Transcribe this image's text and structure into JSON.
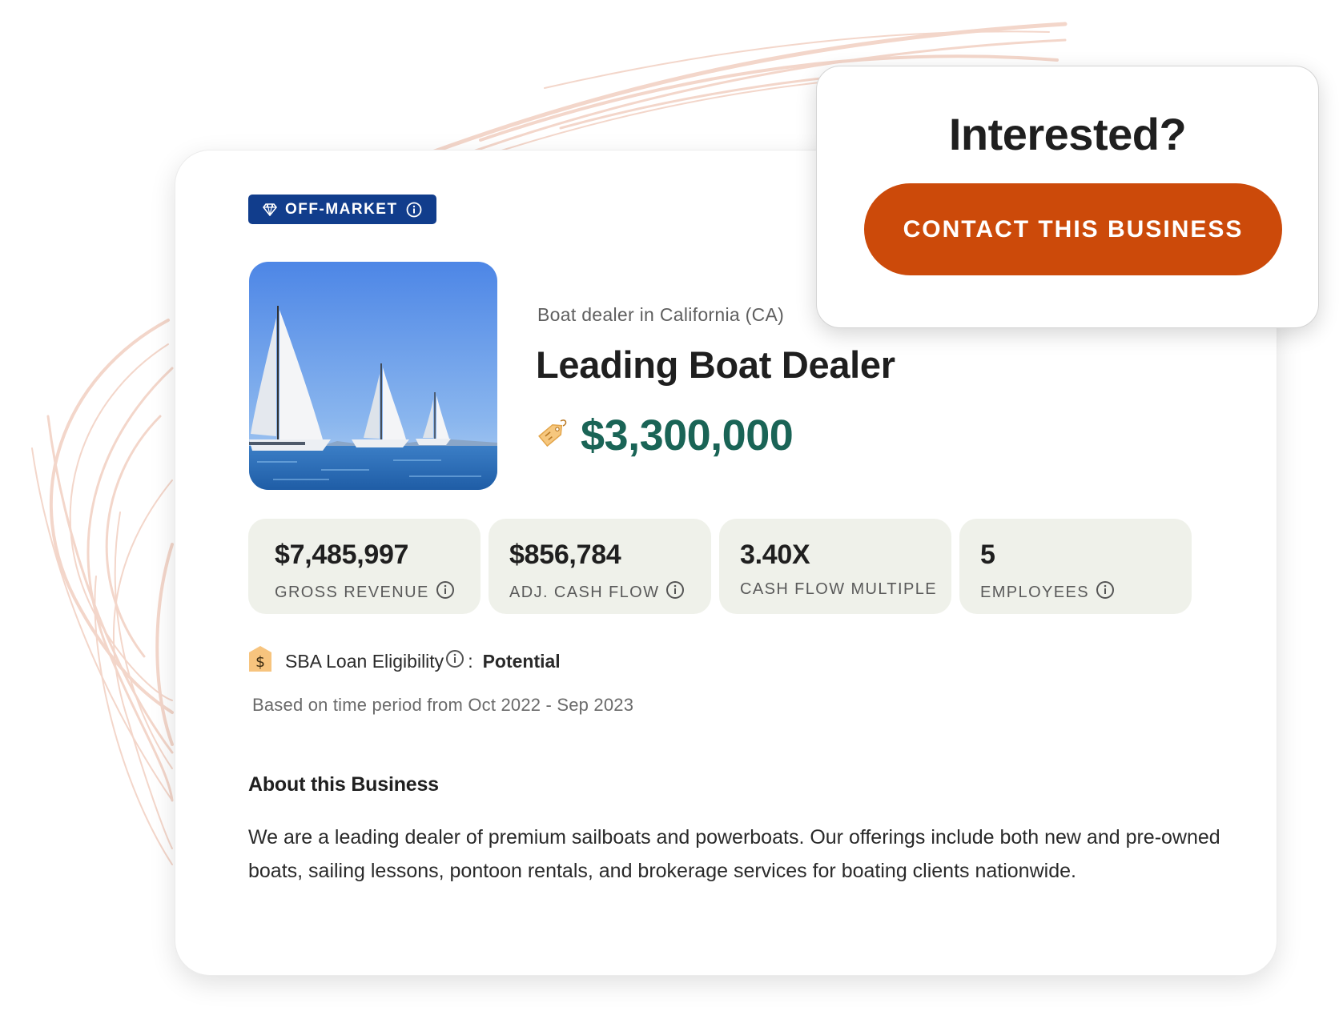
{
  "badge": {
    "label": "OFF-MARKET",
    "color": "#113d8c"
  },
  "listing": {
    "subtitle": "Boat dealer in California (CA)",
    "title": "Leading Boat Dealer",
    "price": "$3,300,000",
    "price_color": "#1a6456",
    "image_alt": "sailboats on water"
  },
  "stats": [
    {
      "value": "$7,485,997",
      "label": "GROSS REVENUE"
    },
    {
      "value": "$856,784",
      "label": "ADJ. CASH FLOW"
    },
    {
      "value": "3.40X",
      "label": "CASH FLOW MULTIPLE"
    },
    {
      "value": "5",
      "label": "EMPLOYEES"
    }
  ],
  "sba": {
    "icon": "$",
    "label": "SBA Loan Eligibility",
    "separator": ":",
    "value": "Potential"
  },
  "period": "Based on time period from Oct 2022 - Sep 2023",
  "about": {
    "heading": "About this Business",
    "text": "We are a leading dealer of premium sailboats and powerboats. Our offerings include both new and pre-owned boats, sailing lessons, pontoon rentals, and brokerage services for boating clients nationwide."
  },
  "cta": {
    "title": "Interested?",
    "button_label": "CONTACT THIS BUSINESS",
    "button_color": "#cc4a0a"
  },
  "icons": {
    "badge_icon": "diamond-icon",
    "badge_info": "info-icon",
    "price_icon": "price-tag-icon",
    "sba_icon": "dollar-tag-icon"
  }
}
